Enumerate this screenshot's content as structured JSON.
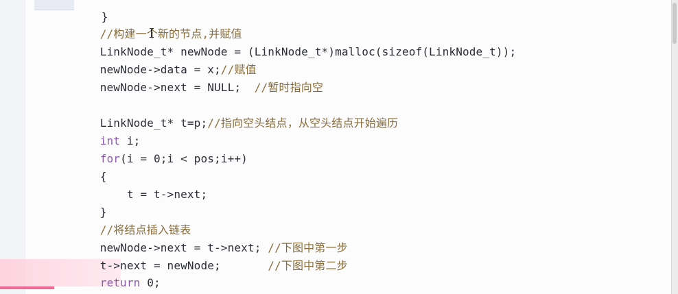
{
  "editor": {
    "language": "C",
    "lines": [
      {
        "id": "closing-brace-top",
        "text": "}"
      },
      {
        "id": "comment-build-node",
        "text": "//构建一个新的节点,并赋值"
      },
      {
        "id": "malloc-line",
        "text": "LinkNode_t* newNode = (LinkNode_t*)malloc(sizeof(LinkNode_t));"
      },
      {
        "id": "assign-data",
        "code": "newNode->data = x;",
        "comment": "//赋值"
      },
      {
        "id": "assign-next-null",
        "code": "newNode->next = NULL;  ",
        "comment": "//暂时指向空"
      },
      {
        "id": "assign-t",
        "code": "LinkNode_t* t=p;",
        "comment": "//指向空头结点，从空头结点开始遍历"
      },
      {
        "id": "decl-i",
        "kw": "int",
        "code": " i;"
      },
      {
        "id": "for-line",
        "kw": "for",
        "code": "(i = 0;i < pos;i++)"
      },
      {
        "id": "open-brace",
        "text": "{"
      },
      {
        "id": "t-advance",
        "text": "    t = t->next;"
      },
      {
        "id": "close-brace",
        "text": "}"
      },
      {
        "id": "comment-insert",
        "text": "//将结点插入链表"
      },
      {
        "id": "link-next",
        "code": "newNode->next = t->next; ",
        "comment": "//下图中第一步"
      },
      {
        "id": "link-t",
        "code": "t->next = newNode;       ",
        "comment": "//下图中第二步"
      },
      {
        "id": "return-line",
        "kw": "return",
        "code": " 0;"
      },
      {
        "id": "closing-brace-bottom",
        "text": "}"
      }
    ]
  },
  "colors": {
    "keyword": "#8b5cb0",
    "comment": "#8a6e3b",
    "text": "#2a2d33",
    "highlight": "#ffd2de",
    "accent_bar": "#ef6a93"
  }
}
